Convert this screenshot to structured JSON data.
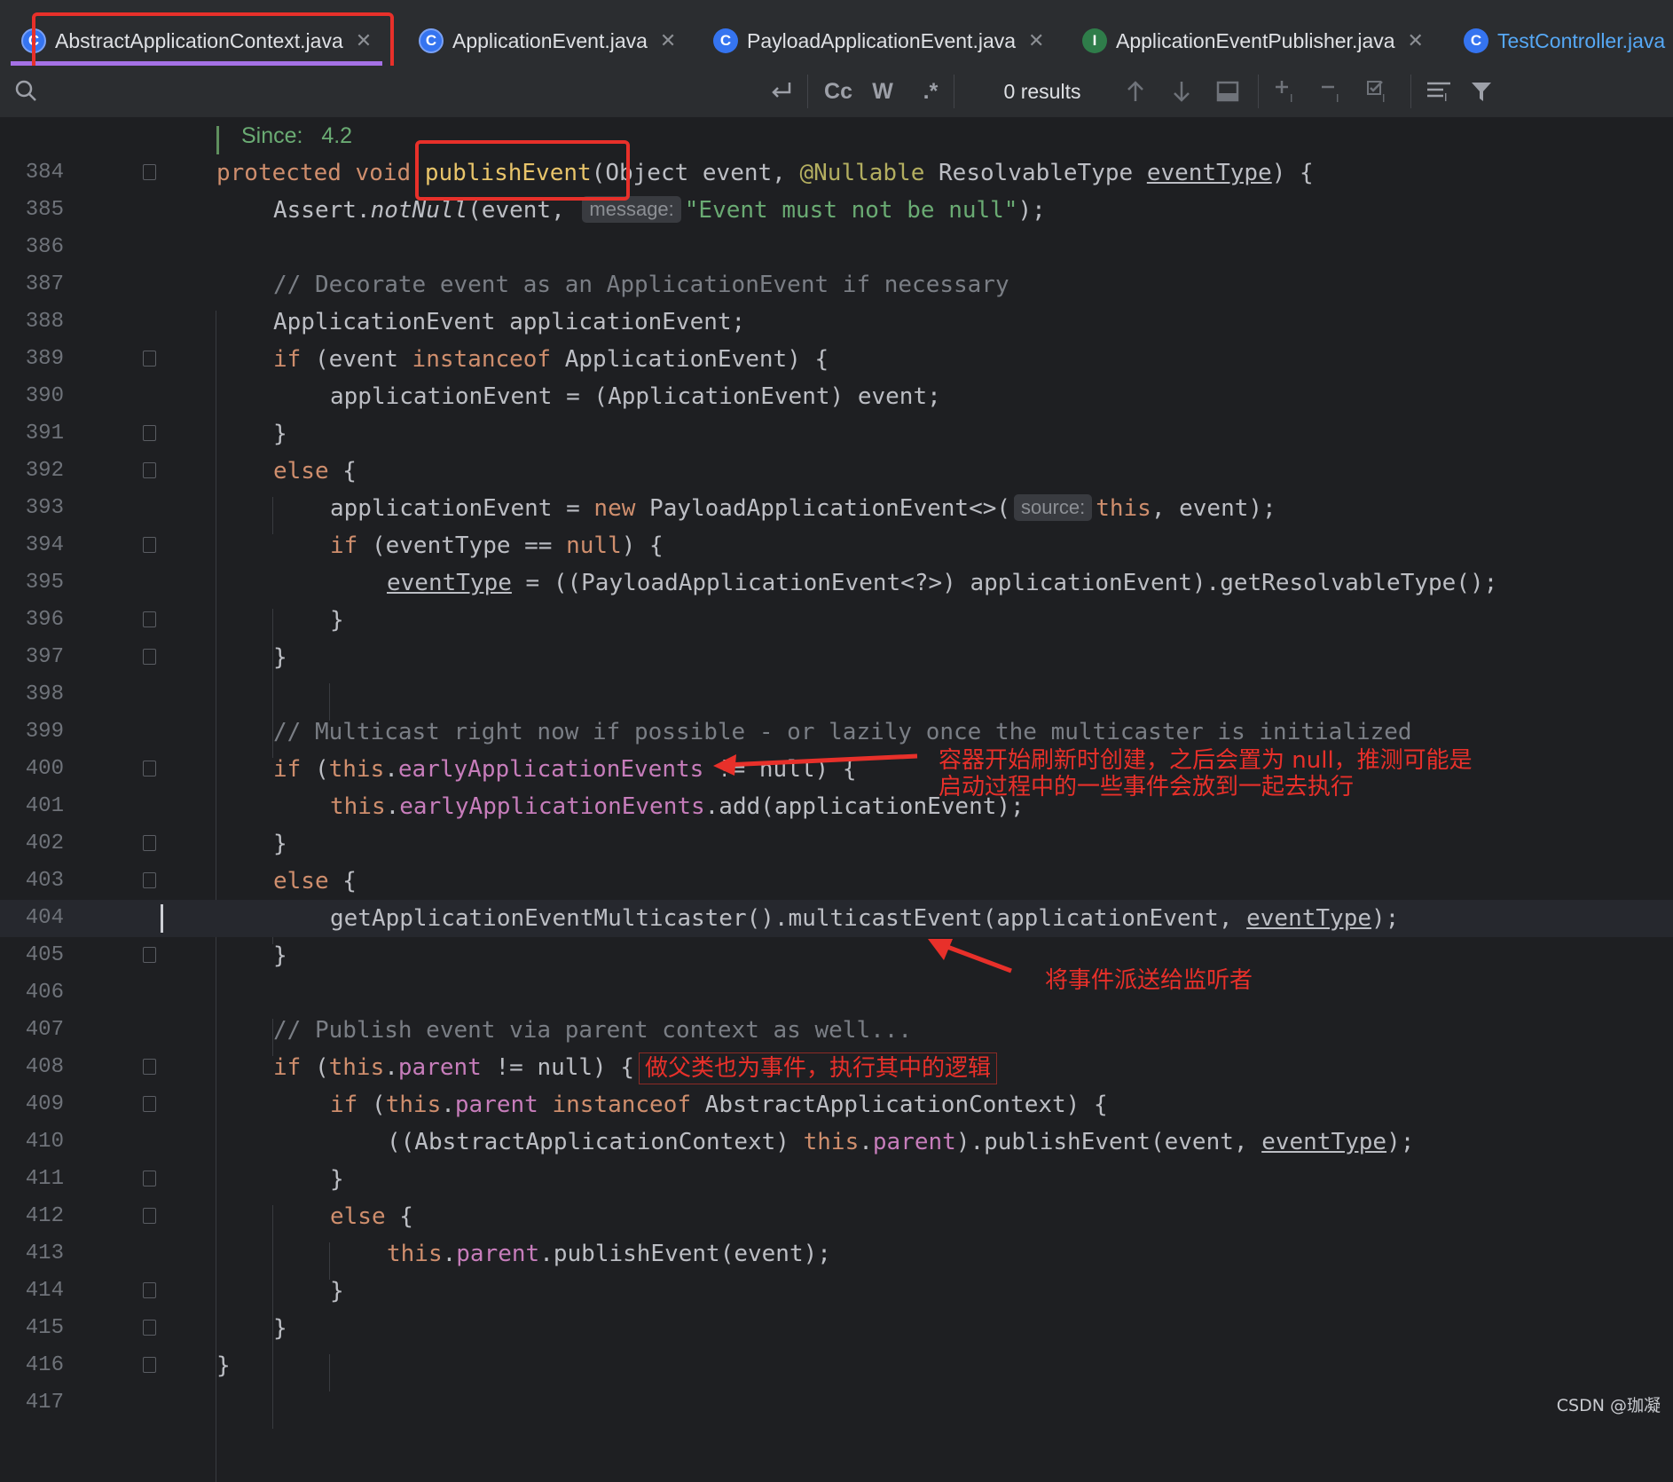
{
  "tabs": [
    {
      "label": "AbstractApplicationContext.java",
      "icon": "abstract-class-icon",
      "active": true
    },
    {
      "label": "ApplicationEvent.java",
      "icon": "abstract-class-icon"
    },
    {
      "label": "PayloadApplicationEvent.java",
      "icon": "class-icon"
    },
    {
      "label": "ApplicationEventPublisher.java",
      "icon": "interface-icon"
    },
    {
      "label": "TestController.java",
      "icon": "class-icon"
    }
  ],
  "search": {
    "results": "0 results",
    "match_case": "Cc",
    "words": "W",
    "regex": ".*"
  },
  "editor": {
    "doc_since_label": "Since:",
    "doc_since_value": "4.2",
    "current_line": "404",
    "line_numbers": [
      "384",
      "385",
      "386",
      "387",
      "388",
      "389",
      "390",
      "391",
      "392",
      "393",
      "394",
      "395",
      "396",
      "397",
      "398",
      "399",
      "400",
      "401",
      "402",
      "403",
      "404",
      "405",
      "406",
      "407",
      "408",
      "409",
      "410",
      "411",
      "412",
      "413",
      "414",
      "415",
      "416",
      "417"
    ],
    "hints": {
      "message": "message:",
      "source": "source:"
    },
    "tokens": {
      "protected": "protected",
      "void": "void",
      "publishEvent": "publishEvent",
      "sig_rest_a": "(Object event, ",
      "nullable": "@Nullable",
      "sig_rest_b": " ResolvableType ",
      "eventType": "eventType",
      "sig_end": ") {",
      "assert": "Assert.",
      "notNull": "notNull",
      "assert_args": "(event, ",
      "assert_msg": "\"Event must not be null\"",
      "assert_end": ");",
      "cmt_decorate": "// Decorate event as an ApplicationEvent if necessary",
      "decl": "ApplicationEvent applicationEvent;",
      "if": "if",
      "else": "else",
      "new": "new",
      "this": "this",
      "instanceof": "instanceof",
      "null": "null",
      "if_open": " (event ",
      "if_type": " ApplicationEvent) {",
      "assign_cast": "applicationEvent = (ApplicationEvent) event;",
      "brace_close": "}",
      "brace_open": " {",
      "assign_new": "applicationEvent = ",
      "payload_ctor": " PayloadApplicationEvent<>(",
      "new_end": ", event);",
      "if_eventtype": " (eventType == ",
      "if_close": ") {",
      "get_resolvable": " = ((PayloadApplicationEvent<?>) applicationEvent).getResolvableType();",
      "cmt_multicast": "// Multicast right now if possible - or lazily once the multicaster is initialized",
      "early_field": "earlyApplicationEvents",
      "neq_null": " != null) {",
      "if_paren": " (",
      "dot": ".",
      "add_call": ".add(applicationEvent);",
      "multicast_call": "getApplicationEventMulticaster().multicastEvent(applicationEvent, ",
      "call_end": ");",
      "cmt_parent": "// Publish event via parent context as well...",
      "parent": "parent",
      "neq_null2": " != null) {",
      "instance_abs": " AbstractApplicationContext) {",
      "cast_abs": "((AbstractApplicationContext) ",
      "publish_args": ").publishEvent(event, ",
      "publish_simple": ".publishEvent(event);"
    }
  },
  "annotations": {
    "early_events_note_line1": "容器开始刷新时创建，之后会置为 null，推测可能是",
    "early_events_note_line2": "启动过程中的一些事件会放到一起去执行",
    "multicast_note": "将事件派送给监听者",
    "parent_note": "做父类也为事件，执行其中的逻辑"
  },
  "watermark": "CSDN @珈凝",
  "colors": {
    "highlight_red": "#e8302a",
    "active_tab_underline": "#a571e6",
    "keyword": "#cf8e6d",
    "field": "#c77dbb",
    "string": "#6aab73"
  }
}
